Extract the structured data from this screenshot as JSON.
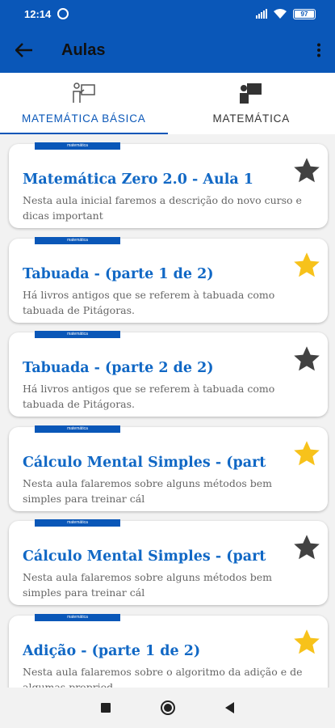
{
  "status_bar": {
    "time": "12:14",
    "battery": "97",
    "alarm_icon": "alarm-icon",
    "signal_icon": "signal-icon",
    "wifi_icon": "wifi-icon"
  },
  "app_bar": {
    "title": "Aulas",
    "back_icon": "arrow-back-icon",
    "menu_icon": "more-vert-icon"
  },
  "tabs": [
    {
      "label": "MATEMÁTICA BÁSICA",
      "icon": "teacher-board-icon",
      "active": true
    },
    {
      "label": "MATEMÁTICA",
      "icon": "lecture-icon",
      "active": false
    }
  ],
  "lessons": [
    {
      "tag": "matemática",
      "title": "Matemática Zero 2.0 - Aula 1",
      "description": "Nesta aula inicial faremos a descrição do novo curso e dicas important",
      "favorite": false
    },
    {
      "tag": "matemática",
      "title": "Tabuada - (parte 1 de 2)",
      "description": "Há livros antigos que se referem à tabuada como tabuada de Pitágoras.",
      "favorite": true
    },
    {
      "tag": "matemática",
      "title": "Tabuada - (parte 2 de 2)",
      "description": "Há livros antigos que se referem à tabuada como tabuada de Pitágoras.",
      "favorite": false
    },
    {
      "tag": "matemática",
      "title": "Cálculo Mental Simples - (part",
      "description": "Nesta aula falaremos sobre alguns métodos bem simples para treinar cál",
      "favorite": true
    },
    {
      "tag": "matemática",
      "title": "Cálculo Mental Simples - (part",
      "description": "Nesta aula falaremos sobre alguns métodos bem simples para treinar cál",
      "favorite": false
    },
    {
      "tag": "matemática",
      "title": "Adição - (parte 1 de 2)",
      "description": "Nesta aula falaremos sobre o algoritmo da adição e de algumas propried",
      "favorite": true
    }
  ],
  "colors": {
    "primary": "#0a57b8",
    "title_blue": "#1168c5",
    "star_gold": "#f7c21b",
    "star_gray": "#424242"
  },
  "nav_bar": {
    "recents_icon": "square-icon",
    "home_icon": "circle-icon",
    "back_icon": "triangle-back-icon"
  }
}
